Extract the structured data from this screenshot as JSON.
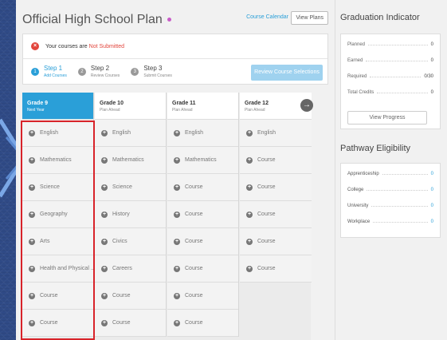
{
  "header": {
    "title": "Official High School Plan",
    "course_calendar": "Course Calendar",
    "view_plans": "View Plans"
  },
  "status": {
    "prefix": "Your courses are",
    "value": "Not Submitted"
  },
  "steps": [
    {
      "title": "Step 1",
      "sub": "Add Courses"
    },
    {
      "title": "Step 2",
      "sub": "Review Courses"
    },
    {
      "title": "Step 3",
      "sub": "Submit Courses"
    }
  ],
  "review_button": "Review Course Selections",
  "grades": [
    {
      "title": "Grade 9",
      "sub": "Next Year",
      "courses": [
        "English",
        "Mathematics",
        "Science",
        "Geography",
        "Arts",
        "Health and Physical ...",
        "Course",
        "Course"
      ]
    },
    {
      "title": "Grade 10",
      "sub": "Plan Ahead",
      "courses": [
        "English",
        "Mathematics",
        "Science",
        "History",
        "Civics",
        "Careers",
        "Course",
        "Course"
      ]
    },
    {
      "title": "Grade 11",
      "sub": "Plan Ahead",
      "courses": [
        "English",
        "Mathematics",
        "Course",
        "Course",
        "Course",
        "Course",
        "Course",
        "Course"
      ]
    },
    {
      "title": "Grade 12",
      "sub": "Plan Ahead",
      "courses": [
        "English",
        "Course",
        "Course",
        "Course",
        "Course",
        "Course"
      ]
    }
  ],
  "graduation": {
    "title": "Graduation Indicator",
    "metrics": [
      {
        "label": "Planned",
        "value": "0"
      },
      {
        "label": "Earned",
        "value": "0"
      },
      {
        "label": "Required",
        "value": "0/30"
      },
      {
        "label": "Total Credits",
        "value": "0"
      }
    ],
    "progress_button": "View Progress"
  },
  "pathway": {
    "title": "Pathway Eligibility",
    "items": [
      {
        "label": "Apprenticeship",
        "value": "0"
      },
      {
        "label": "College",
        "value": "0"
      },
      {
        "label": "University",
        "value": "0"
      },
      {
        "label": "Workplace",
        "value": "0"
      }
    ]
  },
  "colors": {
    "accent": "#2a9fd8",
    "error": "#e2453c",
    "highlight": "#d8232a"
  }
}
